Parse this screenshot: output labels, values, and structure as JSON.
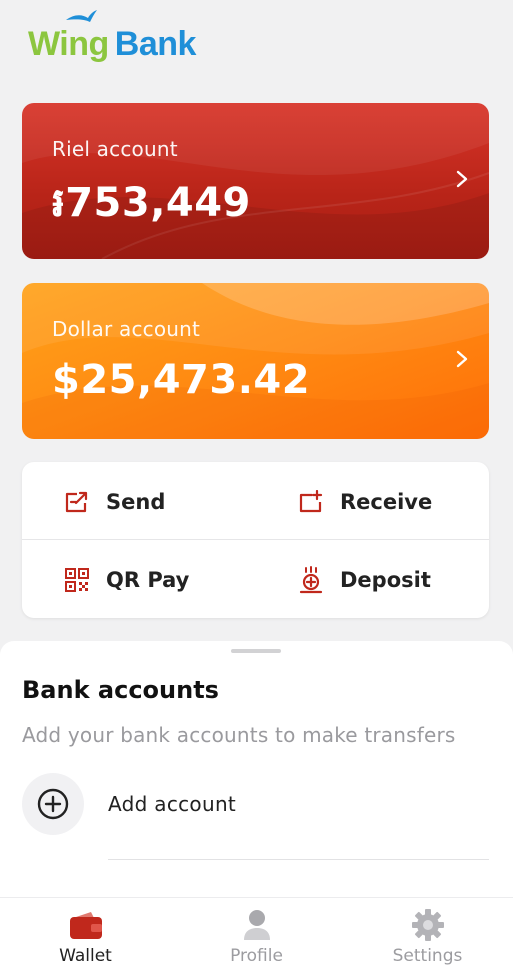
{
  "brand": {
    "wing": "Wing",
    "bank": "Bank",
    "colors": {
      "wing": "#8cc63f",
      "bank": "#1f8fd8",
      "primary_red": "#c0281c"
    }
  },
  "accounts": [
    {
      "label": "Riel account",
      "amount": "៛753,449",
      "icon": "chevron-right-icon"
    },
    {
      "label": "Dollar account",
      "amount": "$25,473.42",
      "icon": "chevron-right-icon"
    }
  ],
  "actions": {
    "send": {
      "label": "Send",
      "icon": "send-icon"
    },
    "receive": {
      "label": "Receive",
      "icon": "receive-icon"
    },
    "qr_pay": {
      "label": "QR Pay",
      "icon": "qr-code-icon"
    },
    "deposit": {
      "label": "Deposit",
      "icon": "deposit-icon"
    }
  },
  "bank_accounts": {
    "title": "Bank accounts",
    "subtitle": "Add your bank accounts to make transfers",
    "add_label": "Add account",
    "add_icon": "plus-circle-icon"
  },
  "tabs": [
    {
      "label": "Wallet",
      "icon": "wallet-icon",
      "active": true
    },
    {
      "label": "Profile",
      "icon": "profile-icon",
      "active": false
    },
    {
      "label": "Settings",
      "icon": "gear-icon",
      "active": false
    }
  ]
}
